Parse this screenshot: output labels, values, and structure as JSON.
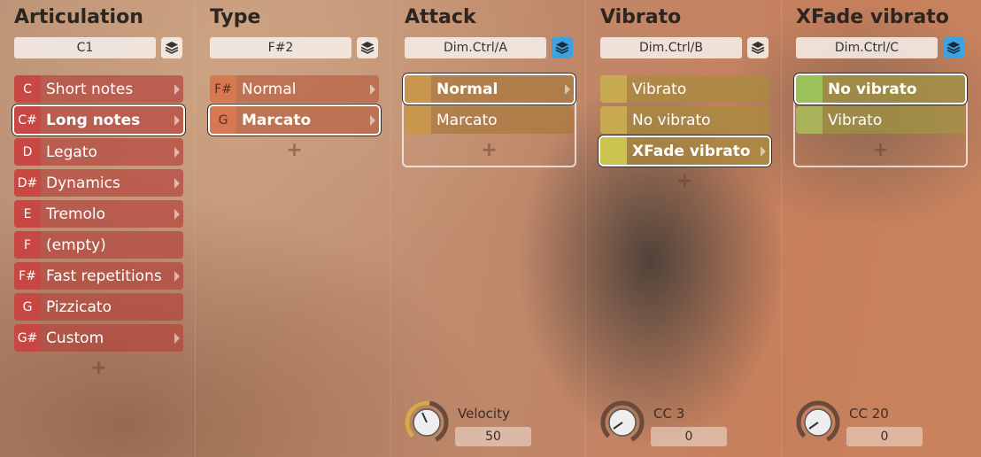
{
  "colors": {
    "accent_blue": "#3aa3e0",
    "articulation_key": "#c84842",
    "type_key": "#d7784e",
    "attack_key": "#c8964e",
    "vibrato_key": "#c7aa52",
    "xfade_key": "#a8b35a"
  },
  "columns": [
    {
      "title": "Articulation",
      "key_field": "C1",
      "layer_active": false,
      "rows": [
        {
          "key": "C",
          "label": "Short notes",
          "arrow": true,
          "selected": false
        },
        {
          "key": "C#",
          "label": "Long notes",
          "arrow": true,
          "selected": true
        },
        {
          "key": "D",
          "label": "Legato",
          "arrow": true,
          "selected": false
        },
        {
          "key": "D#",
          "label": "Dynamics",
          "arrow": true,
          "selected": false
        },
        {
          "key": "E",
          "label": "Tremolo",
          "arrow": true,
          "selected": false
        },
        {
          "key": "F",
          "label": "(empty)",
          "arrow": false,
          "selected": false
        },
        {
          "key": "F#",
          "label": "Fast repetitions",
          "arrow": true,
          "selected": false
        },
        {
          "key": "G",
          "label": "Pizzicato",
          "arrow": false,
          "selected": false
        },
        {
          "key": "G#",
          "label": "Custom",
          "arrow": true,
          "selected": false
        }
      ],
      "plus": "+"
    },
    {
      "title": "Type",
      "key_field": "F#2",
      "layer_active": false,
      "rows": [
        {
          "key": "F#",
          "label": "Normal",
          "arrow": true,
          "selected": false
        },
        {
          "key": "G",
          "label": "Marcato",
          "arrow": true,
          "selected": true
        }
      ],
      "plus": "+"
    },
    {
      "title": "Attack",
      "key_field": "Dim.Ctrl/A",
      "layer_active": true,
      "rows": [
        {
          "key": "",
          "label": "Normal",
          "arrow": true,
          "selected": true
        },
        {
          "key": "",
          "label": "Marcato",
          "arrow": false,
          "selected": false
        }
      ],
      "plus": "+",
      "knob": {
        "label": "Velocity",
        "value": "50"
      }
    },
    {
      "title": "Vibrato",
      "key_field": "Dim.Ctrl/B",
      "layer_active": false,
      "rows": [
        {
          "key": "",
          "label": "Vibrato",
          "arrow": false,
          "selected": false
        },
        {
          "key": "",
          "label": "No vibrato",
          "arrow": false,
          "selected": false
        },
        {
          "key": "",
          "label": "XFade vibrato",
          "arrow": true,
          "selected": true
        }
      ],
      "plus": "+",
      "knob": {
        "label": "CC 3",
        "value": "0"
      }
    },
    {
      "title": "XFade vibrato",
      "key_field": "Dim.Ctrl/C",
      "layer_active": true,
      "rows": [
        {
          "key": "",
          "label": "No vibrato",
          "arrow": false,
          "selected": true
        },
        {
          "key": "",
          "label": "Vibrato",
          "arrow": false,
          "selected": false
        }
      ],
      "plus": "+",
      "knob": {
        "label": "CC 20",
        "value": "0"
      }
    }
  ]
}
